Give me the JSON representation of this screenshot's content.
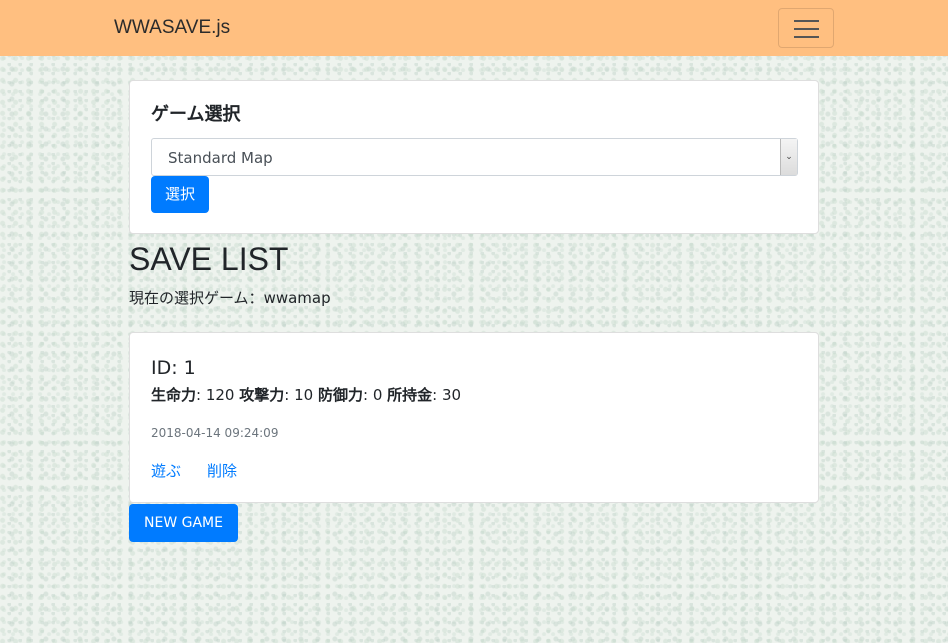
{
  "navbar": {
    "brand": "WWASAVE.js",
    "toggler_icon": "hamburger-menu-icon",
    "background": "#ffbf80"
  },
  "game_select": {
    "title": "ゲーム選択",
    "selected_option": "Standard Map",
    "select_button": "選択"
  },
  "save_list": {
    "title": "SAVE LIST",
    "current_game_label": "現在の選択ゲーム：",
    "current_game_value": "wwamap",
    "entries": [
      {
        "id_label": "ID: 1",
        "stats": [
          {
            "label": "生命力",
            "value": "120"
          },
          {
            "label": "攻撃力",
            "value": "10"
          },
          {
            "label": "防御力",
            "value": "0"
          },
          {
            "label": "所持金",
            "value": "30"
          }
        ],
        "timestamp": "2018-04-14 09:24:09",
        "play_link": "遊ぶ",
        "delete_link": "削除"
      }
    ],
    "new_game_button": "NEW GAME"
  },
  "colors": {
    "primary": "#007bff",
    "muted": "#6c757d"
  }
}
